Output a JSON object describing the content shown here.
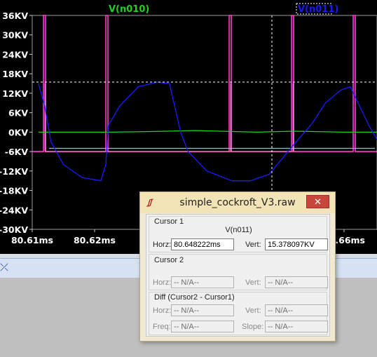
{
  "plot": {
    "traces": [
      {
        "name": "V(n010)",
        "color": "#22d022"
      },
      {
        "name": "V(n011)",
        "color": "#1a1aff"
      }
    ],
    "y_tick_labels": [
      "36KV",
      "30KV",
      "24KV",
      "18KV",
      "12KV",
      "6KV",
      "0KV",
      "-6KV",
      "-12KV",
      "-18KV",
      "-24KV",
      "-30KV"
    ],
    "x_tick_labels": [
      "80.61ms",
      "80.62ms",
      "80.66ms"
    ],
    "pink_color": "#ff3ad0"
  },
  "chart_data": {
    "type": "line",
    "xlabel": "",
    "ylabel": "",
    "x_ticks": [
      "80.61ms",
      "80.62ms",
      "80.66ms"
    ],
    "ylim": [
      -30,
      36
    ],
    "y_unit": "KV",
    "grid": false,
    "series": [
      {
        "name": "V(n010)",
        "color": "#22d022",
        "x": [
          80.611,
          80.6175,
          80.6228,
          80.63,
          80.636,
          80.64,
          80.646,
          80.652,
          80.66,
          80.67
        ],
        "y": [
          0,
          0,
          0,
          0.2,
          0.5,
          0.3,
          0,
          0.3,
          0,
          0
        ]
      },
      {
        "name": "V(n011)",
        "color": "#1a1aff",
        "x": [
          80.611,
          80.612,
          80.613,
          80.615,
          80.618,
          80.621,
          80.6218,
          80.6222,
          80.624,
          80.627,
          80.63,
          80.632,
          80.6338,
          80.635,
          80.638,
          80.642,
          80.645,
          80.648,
          80.651,
          80.655,
          80.657,
          80.6595,
          80.661,
          80.664,
          80.667
        ],
        "y": [
          15,
          8,
          -3,
          -10,
          -14,
          -15,
          -10,
          2,
          8,
          14,
          15.4,
          15,
          0,
          -6,
          -12,
          -15,
          -15,
          -13,
          -6,
          3,
          9,
          13,
          14,
          2,
          -8
        ]
      }
    ]
  },
  "dialog": {
    "title": "simple_cockroft_V3.raw",
    "icon": "ltspice-logo-icon",
    "close_label": "✕",
    "cursor1": {
      "label": "Cursor 1",
      "signal": "V(n011)",
      "horz_label": "Horz:",
      "horz_value": "80.648222ms",
      "vert_label": "Vert:",
      "vert_value": "15.378097KV"
    },
    "cursor2": {
      "label": "Cursor 2",
      "horz_label": "Horz:",
      "horz_value": "-- N/A--",
      "vert_label": "Vert:",
      "vert_value": "-- N/A--"
    },
    "diff": {
      "label": "Diff (Cursor2 - Cursor1)",
      "horz_label": "Horz:",
      "horz_value": "-- N/A--",
      "vert_label": "Vert:",
      "vert_value": "-- N/A--",
      "freq_label": "Freq:",
      "freq_value": "-- N/A--",
      "slope_label": "Slope:",
      "slope_value": "-- N/A--"
    }
  }
}
